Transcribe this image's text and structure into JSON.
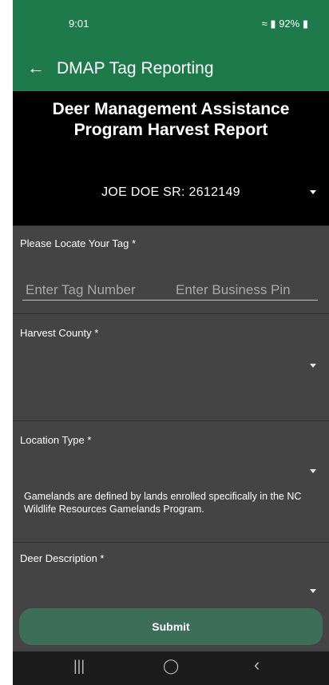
{
  "status_bar": {
    "time": "9:01",
    "battery": "92%"
  },
  "app_bar": {
    "title": "DMAP Tag Reporting"
  },
  "hero": {
    "heading_line1": "Deer Management Assistance",
    "heading_line2": "Program Harvest Report",
    "user_info": "JOE DOE SR:  2612149"
  },
  "tag_section": {
    "label": "Please Locate Your Tag *",
    "tag_number_placeholder": "Enter Tag Number",
    "business_pin_placeholder": "Enter Business Pin"
  },
  "harvest_county": {
    "label": "Harvest County *"
  },
  "location_type": {
    "label": "Location Type *",
    "note": "Gamelands are defined by lands enrolled specifically in the NC Wildlife Resources Gamelands Program."
  },
  "deer_description": {
    "label": "Deer Description *"
  },
  "submit": {
    "label": "Submit"
  },
  "nav_bar": {
    "recent": "|||",
    "home": "◯",
    "back": "‹"
  },
  "colors": {
    "brand_green": "#1e7a4a",
    "button_green": "#3d6e57",
    "panel_gray": "#444444"
  }
}
